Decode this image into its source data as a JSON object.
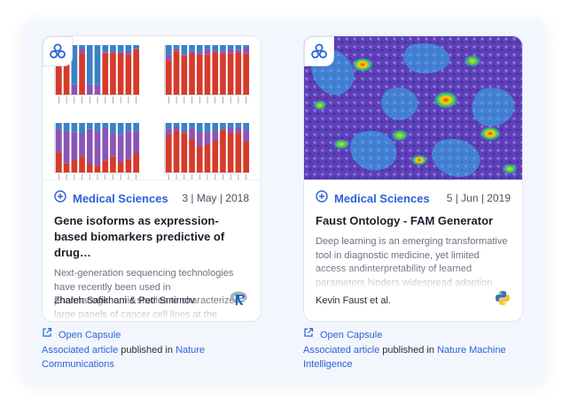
{
  "cards": [
    {
      "category": "Medical Sciences",
      "date": "3 | May | 2018",
      "title": "Gene isoforms as expression-based biomarkers predictive of drug…",
      "description": "Next-generation sequencing technologies have recently been used in pharmacogenomic studies to characterize large panels of cancer cell lines at the",
      "authors": "Zhaleh Safikhani & Petr Smirnov",
      "language_icon": "r-logo-icon",
      "thumbnail": "stacked-bar-charts",
      "open_capsule": "Open Capsule",
      "associated_article": "Associated article",
      "published_in": "published in",
      "journal": "Nature Communications"
    },
    {
      "category": "Medical Sciences",
      "date": "5 | Jun | 2019",
      "title": "Faust Ontology - FAM Generator",
      "description": "Deep learning is an emerging transformative tool in diagnostic medicine, yet limited access andinterpretability of learned parameters hinders widespread adoption. Here, we generated a diverserepository of",
      "authors": "Kevin Faust et al.",
      "language_icon": "python-logo-icon",
      "thumbnail": "histology-heatmap",
      "open_capsule": "Open Capsule",
      "associated_article": "Associated article",
      "published_in": "published in",
      "journal": "Nature Machine Intelligence"
    }
  ],
  "colors": {
    "accent": "#2b62d9",
    "panel": "#f3f6fc",
    "bar_red": "#d63a2a",
    "bar_purple": "#8a55b5",
    "bar_blue": "#3b82c4"
  }
}
